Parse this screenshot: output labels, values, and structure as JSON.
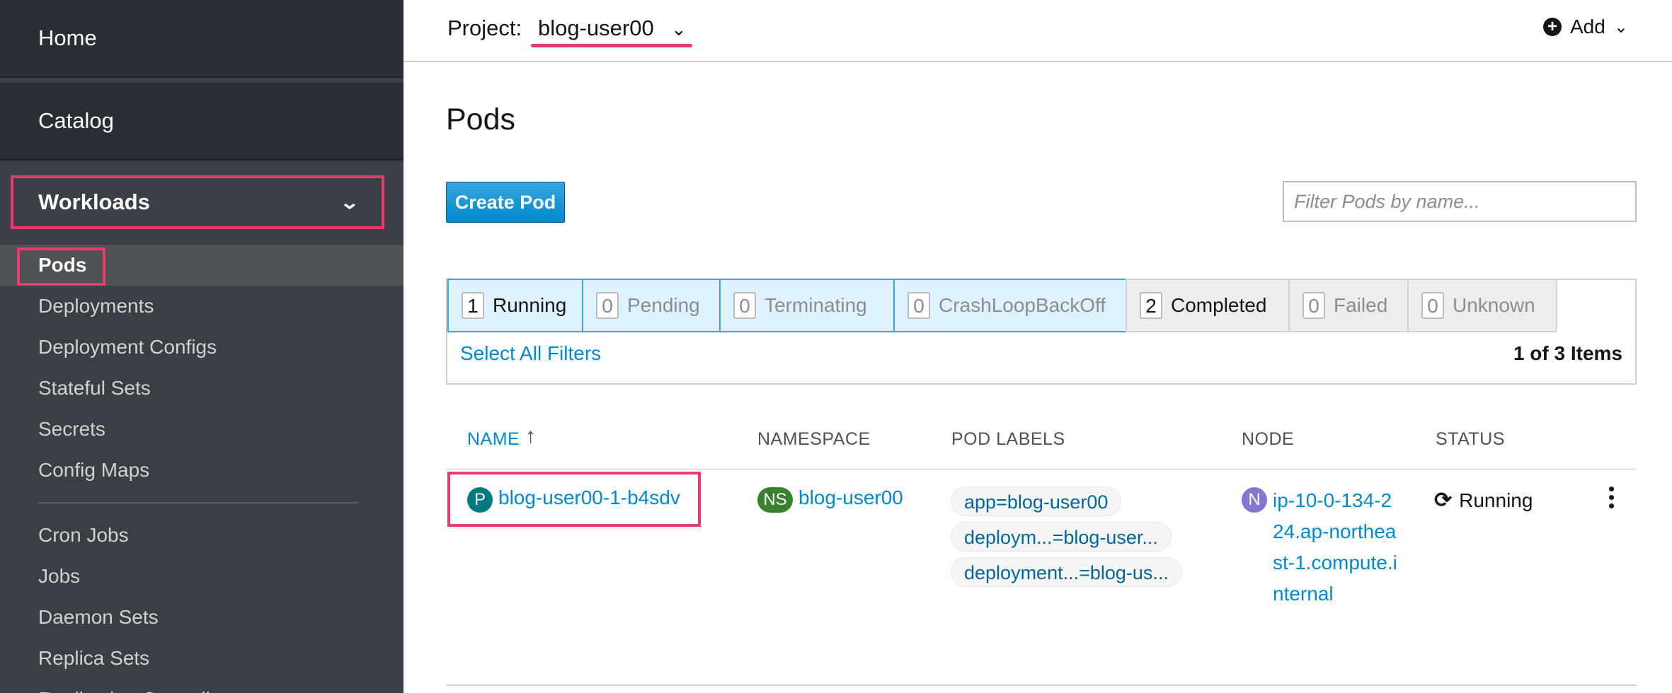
{
  "sidebar": {
    "home": "Home",
    "catalog": "Catalog",
    "workloads": "Workloads",
    "items": [
      "Pods",
      "Deployments",
      "Deployment Configs",
      "Stateful Sets",
      "Secrets",
      "Config Maps"
    ],
    "items2": [
      "Cron Jobs",
      "Jobs",
      "Daemon Sets",
      "Replica Sets",
      "Replication Controllers"
    ]
  },
  "topbar": {
    "project_label": "Project:",
    "project_value": "blog-user00",
    "add_label": "Add"
  },
  "page": {
    "title": "Pods",
    "create_button": "Create Pod",
    "filter_placeholder": "Filter Pods by name..."
  },
  "status_filters": [
    {
      "count": "1",
      "label": "Running"
    },
    {
      "count": "0",
      "label": "Pending"
    },
    {
      "count": "0",
      "label": "Terminating"
    },
    {
      "count": "0",
      "label": "CrashLoopBackOff"
    },
    {
      "count": "2",
      "label": "Completed"
    },
    {
      "count": "0",
      "label": "Failed"
    },
    {
      "count": "0",
      "label": "Unknown"
    }
  ],
  "select_all": "Select All Filters",
  "items_count": "1 of 3 Items",
  "table": {
    "headers": {
      "name": "NAME",
      "namespace": "NAMESPACE",
      "labels": "POD LABELS",
      "node": "NODE",
      "status": "STATUS"
    },
    "row": {
      "name_badge": "P",
      "name": "blog-user00-1-b4sdv",
      "ns_badge": "NS",
      "namespace": "blog-user00",
      "labels": [
        "app=blog-user00",
        "deploym...=blog-user...",
        "deployment...=blog-us..."
      ],
      "node_badge": "N",
      "node": "ip-10-0-134-224.ap-northeast-1.compute.internal",
      "status": "Running"
    }
  },
  "colors": {
    "highlight": "#ec3a6e",
    "link": "#0088ce",
    "badge_pod": "#00797f",
    "badge_ns": "#38812f",
    "badge_node": "#8476d1"
  }
}
